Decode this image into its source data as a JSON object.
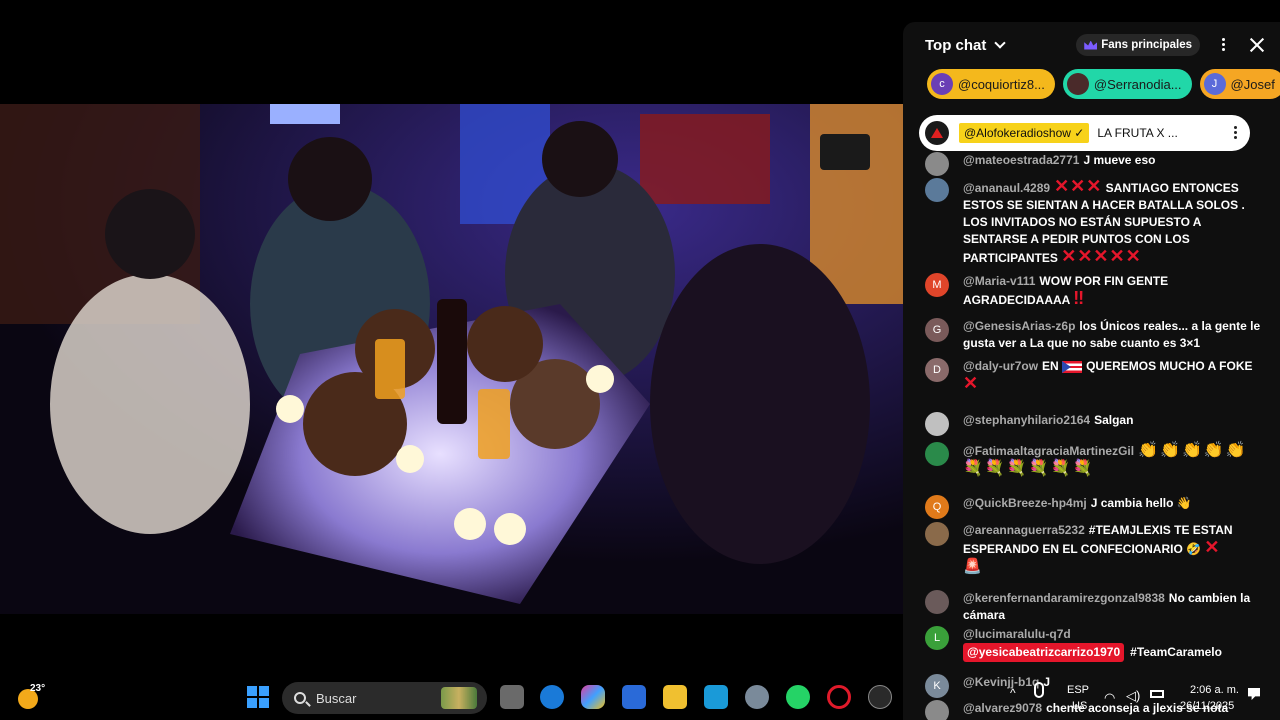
{
  "chat": {
    "title": "Top chat",
    "fans_label": "Fans principales",
    "tickers": [
      {
        "label": "@coquiortiz8...",
        "initial": "c",
        "bg": "#f4b81c",
        "avatar_bg": "#6a3fb5"
      },
      {
        "label": "@Serranodia...",
        "initial": "",
        "bg": "#21d7a8",
        "avatar_bg": "#4a2a2a"
      },
      {
        "label": "@Josef",
        "initial": "J",
        "bg": "#f5a623",
        "avatar_bg": "#5b6bd9"
      }
    ],
    "pinned": {
      "author": "@Alofokeradioshow",
      "check": "✓",
      "text": "LA FRUTA X ..."
    },
    "messages": [
      {
        "author": "@mateoestrada2771",
        "text": "J mueve eso",
        "initial": "",
        "avatar_bg": "#8a8a8a"
      },
      {
        "author": "@ananaul.4289",
        "text": "SANTIAGO ENTONCES ESTOS SE SIENTAN A HACER BATALLA SOLOS . LOS INVITADOS NO ESTÁN SUPUESTO A SENTARSE A PEDIR PUNTOS CON LOS PARTICIPANTES",
        "initial": "",
        "avatar_bg": "#5b7a9a"
      },
      {
        "author": "@Maria-v111",
        "text": "WOW POR FIN GENTE AGRADECIDAAAA",
        "initial": "M",
        "avatar_bg": "#e0452a"
      },
      {
        "author": "@GenesisArias-z6p",
        "text": "los Únicos reales... a la gente le gusta ver a La que no sabe cuanto es 3×1",
        "initial": "G",
        "avatar_bg": "#7a5a5a"
      },
      {
        "author": "@daly-ur7ow",
        "text": "EN",
        "text2": "QUEREMOS MUCHO A FOKE",
        "initial": "D",
        "avatar_bg": "#8a6a6a"
      },
      {
        "author": "@stephanyhilario2164",
        "text": "Salgan",
        "initial": "",
        "avatar_bg": "#c0c0c0"
      },
      {
        "author": "@FatimaaltagraciaMartinezGil",
        "text": "👏👏👏👏👏💐💐💐💐💐💐",
        "initial": "",
        "avatar_bg": "#2a8a4a"
      },
      {
        "author": "@QuickBreeze-hp4mj",
        "text": "J cambia hello 👋",
        "initial": "Q",
        "avatar_bg": "#e07a1a"
      },
      {
        "author": "@areannaguerra5232",
        "text": "#TEAMJLEXIS TE ESTAN ESPERANDO EN EL CONFECIONARIO 🤣",
        "initial": "",
        "avatar_bg": "#8a6a4a"
      },
      {
        "author": "@kerenfernandaramirezgonzal9838",
        "text": "No cambien la cámara",
        "initial": "",
        "avatar_bg": "#6a5a5a"
      },
      {
        "author": "@lucimaralulu-q7d",
        "mention": "@yesicabeatrizcarrizo1970",
        "text": "#TeamCaramelo",
        "initial": "L",
        "avatar_bg": "#3aa03a"
      },
      {
        "author": "@Kevinjj-b1q",
        "text": "J",
        "initial": "K",
        "avatar_bg": "#7a8a9a"
      },
      {
        "author": "@alvarez9078",
        "text": "chente aconseja a jlexis se nota",
        "initial": "",
        "avatar_bg": "#8a8a8a"
      }
    ]
  },
  "taskbar": {
    "weather_temp": "23°",
    "search_placeholder": "Buscar",
    "lang_top": "ESP",
    "lang_bottom": "US",
    "time": "2:06 a. m.",
    "date": "26/11/2025"
  },
  "colors": {
    "chat_bg": "#0f0f0f",
    "author_gray": "#aaaaaa",
    "red_x": "#e5162b",
    "pinned_chip": "#f7d21a"
  }
}
